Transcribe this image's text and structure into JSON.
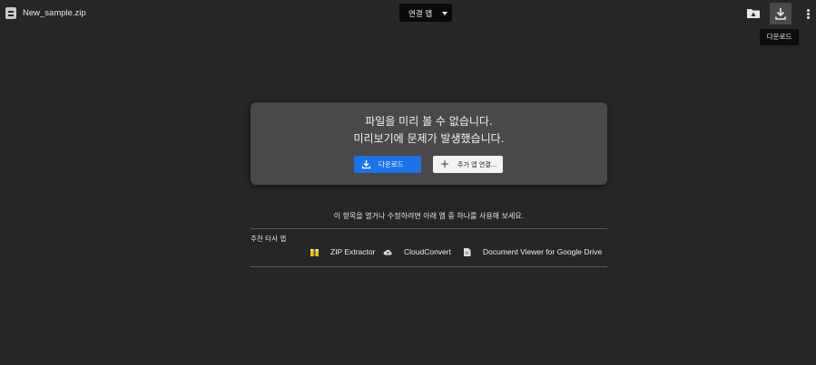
{
  "header": {
    "file_name": "New_sample.zip",
    "open_with_label": "연결 앱",
    "download_tooltip": "다운로드",
    "icons": {
      "file": "zip-file-icon",
      "add_to_drive": "add-to-drive-icon",
      "download": "download-icon",
      "more": "more-vert-icon"
    }
  },
  "preview": {
    "line1": "파일을 미리 볼 수 없습니다.",
    "line2": "미리보기에 문제가 발생했습니다.",
    "download_label": "다운로드",
    "more_apps_label": "주가 앱 연결..."
  },
  "suggestions": {
    "hint": "이 항목을 열거나 수정하려면 아래 앱 중 하나를 사용해 보세요.",
    "label": "추천 타사 앱",
    "apps": [
      {
        "name": "ZIP Extractor",
        "icon": "zip-extractor-icon"
      },
      {
        "name": "CloudConvert",
        "icon": "cloudconvert-icon"
      },
      {
        "name": "Document Viewer for Google Drive",
        "icon": "document-viewer-icon"
      }
    ]
  },
  "colors": {
    "background": "#262626",
    "card": "#4a484b",
    "primary_button": "#1a73e8",
    "secondary_button": "#f3f3f3"
  }
}
